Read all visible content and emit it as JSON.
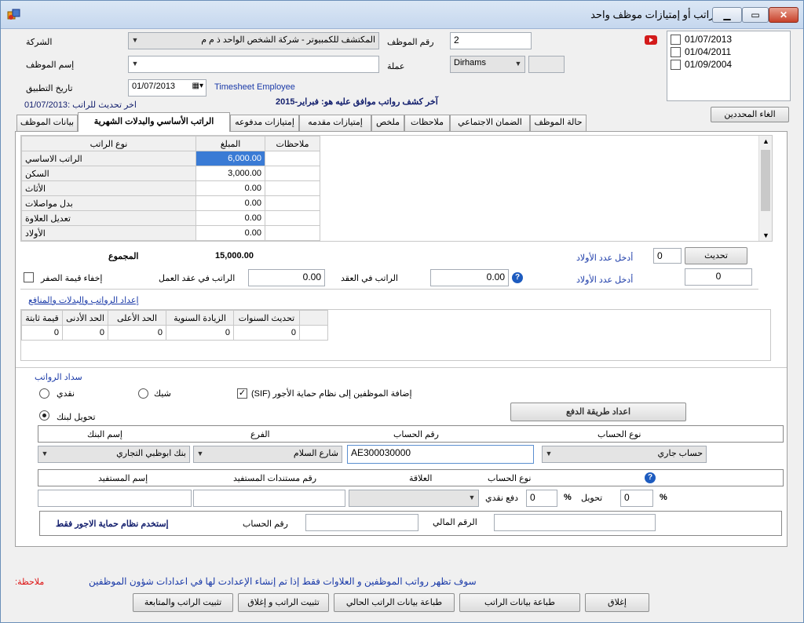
{
  "window": {
    "title": "إنشاء / تعديل راتب أو إمتيازات موظف واحد"
  },
  "header": {
    "company_label": "الشركة",
    "company_value": "المكتشف للكمبيوتر - شركة الشخص الواحد ذ م م",
    "employee_no_label": "رقم الموظف",
    "employee_no_value": "2",
    "employee_name_label": "إسم الموظف",
    "employee_name_value": "",
    "currency_label": "عملة",
    "currency_value": "Dirhams",
    "apply_date_label": "تاريخ التطبيق",
    "apply_date_value": "01/07/2013",
    "timesheet_label": "Timesheet Employee",
    "last_update_label": "اخر تحديث للراتب :01/07/2013",
    "last_approved_label": "آخر كشف رواتب موافق عليه هو: فبراير-2015",
    "dates": [
      "01/07/2013",
      "01/04/2011",
      "01/09/2004"
    ],
    "cancel_selected_label": "الغاء المحددين"
  },
  "tabs": [
    {
      "label": "بيانات الموظف"
    },
    {
      "label": "الراتب الأساسي والبدلات الشهرية",
      "active": true
    },
    {
      "label": "إمتيازات مدفوعه"
    },
    {
      "label": "إمتيازات مقدمه"
    },
    {
      "label": "ملخص"
    },
    {
      "label": "ملاحظات"
    },
    {
      "label": "الضمان الاجتماعي"
    },
    {
      "label": "حالة الموظف"
    }
  ],
  "salary_table": {
    "headers": {
      "type": "نوع الراتب",
      "amount": "المبلغ",
      "notes": "ملاحظات"
    },
    "rows": [
      {
        "type": "الراتب الاساسي",
        "amount": "6,000.00",
        "notes": ""
      },
      {
        "type": "السكن",
        "amount": "3,000.00",
        "notes": ""
      },
      {
        "type": "الأثاث",
        "amount": "0.00",
        "notes": ""
      },
      {
        "type": "بدل مواصلات",
        "amount": "0.00",
        "notes": ""
      },
      {
        "type": "تعديل العلاوة",
        "amount": "0.00",
        "notes": ""
      },
      {
        "type": "الأولاد",
        "amount": "0.00",
        "notes": ""
      }
    ]
  },
  "totals": {
    "total_label": "المجموع",
    "total_value": "15,000.00",
    "hide_zero_label": "إخفاء قيمة الصفر",
    "work_contract_label": "الراتب في عقد العمل",
    "work_contract_value": "0.00",
    "contract_label": "الراتب في العقد",
    "contract_value": "0.00",
    "children_label_1": "أدخل عدد الأولاد",
    "children_value_1": "0",
    "update_button": "تحديث",
    "children_label_2": "أدخل عدد الأولاد",
    "children_value_2": "0"
  },
  "setup_link": "إعداد الرواتب والبدلات والمنافع",
  "years_table": {
    "headers": [
      "تحديث السنوات",
      "الزيادة السنوية",
      "الحد الأعلى",
      "الحد الأدنى",
      "قيمة ثابتة"
    ],
    "row": [
      "0",
      "0",
      "0",
      "0",
      "0"
    ]
  },
  "payment": {
    "section_label": "سداد الرواتب",
    "cash_label": "نقدي",
    "cheque_label": "شيك",
    "sif_label": "(SIF) إضافة الموظفين إلى نظام حماية الأجور",
    "bank_transfer_label": "تحويل لبنك",
    "setup_payment_button": "اعداد طريقة الدفع",
    "bank_headers": {
      "bank_name": "إسم البنك",
      "branch": "الفرع",
      "account_no": "رقم الحساب",
      "account_type": "نوع الحساب"
    },
    "bank_name": "بنك ابوظبي التجاري",
    "branch": "شارع السلام",
    "account_no": "AE300030000",
    "account_type": "حساب جاري",
    "beneficiary_headers": {
      "name": "إسم المستفيد",
      "docs": "رقم مستندات المستفيد",
      "relation": "العلاقة",
      "account_type": "نوع الحساب"
    },
    "beneficiary_name": "",
    "beneficiary_docs": "",
    "relation": "",
    "cash_pay_label": "دفع نقدي",
    "cash_pay_value": "0",
    "percent_symbol": "%",
    "transfer_label": "تحويل",
    "transfer_value": "0",
    "financial_no_label": "الرقم المالي",
    "financial_no_value": "",
    "account_no_label": "رقم الحساب",
    "account_no_value": "",
    "wps_only_label": "إستخدم نظام حماية الاجور فقط"
  },
  "footer": {
    "note_label": ":ملاحظة",
    "note_text": "سوف تظهر رواتب الموظفين و العلاوات فقط إذا تم إنشاء الإعدادت لها في اعدادات شؤون الموظفين",
    "buttons": [
      "تثبيت الراتب والمتابعة",
      "تثبيت الراتب و إغلاق",
      "طباعة بيانات الراتب الحالي",
      "طباعة بيانات الراتب",
      "إغلاق"
    ]
  },
  "colors": {
    "accent_blue": "#1a3aa8",
    "note_red": "#dd1111",
    "selected_cell": "#3a7bd5"
  }
}
